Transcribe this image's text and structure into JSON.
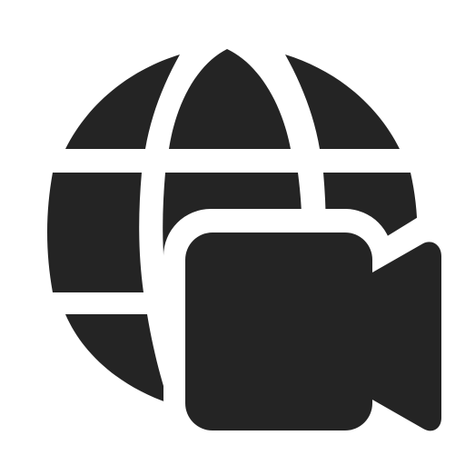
{
  "icon": {
    "name": "globe-video-icon",
    "parts": [
      "globe-icon",
      "video-camera-icon"
    ],
    "fill_color": "#242424",
    "background_color": "#ffffff"
  }
}
